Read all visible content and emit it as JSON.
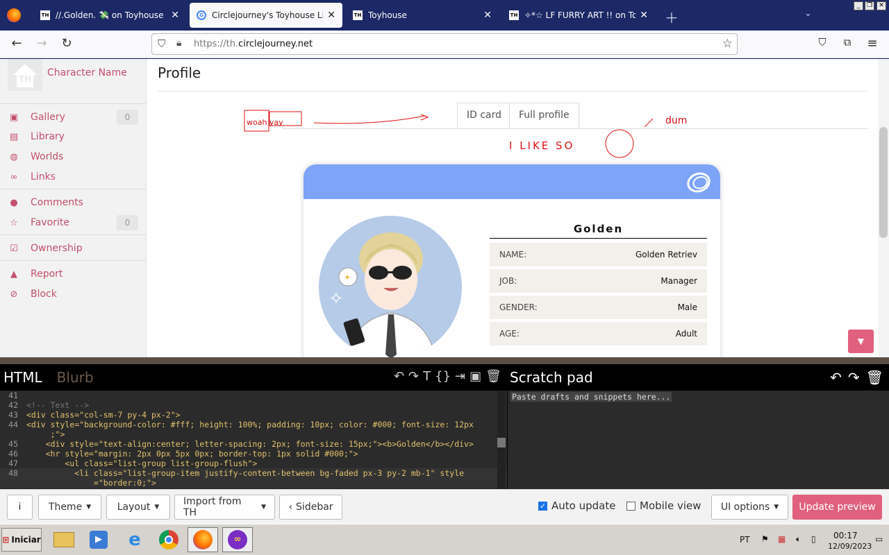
{
  "browser": {
    "tabs": [
      {
        "title": "//.Golden. 💸 on Toyhouse",
        "favicon": "TH",
        "active": false
      },
      {
        "title": "Circlejourney's Toyhouse Live Code Editor",
        "favicon": "G",
        "active": true
      },
      {
        "title": "Toyhouse",
        "favicon": "TH",
        "active": false
      },
      {
        "title": "✧*☆ LF FURRY ART !! on Toyhouse",
        "favicon": "TH",
        "active": false
      }
    ],
    "url_prefix": "https://th.",
    "url_domain": "circlejourney.net"
  },
  "sidebar": {
    "logo_text": "TH",
    "character_name": "Character Name",
    "items": [
      {
        "label": "Gallery",
        "icon": "image-icon",
        "count": "0"
      },
      {
        "label": "Library",
        "icon": "book-icon"
      },
      {
        "label": "Worlds",
        "icon": "globe-icon"
      },
      {
        "label": "Links",
        "icon": "link-icon"
      },
      {
        "label": "Comments",
        "icon": "comment-icon"
      },
      {
        "label": "Favorite",
        "icon": "star-icon",
        "count": "0"
      },
      {
        "label": "Ownership",
        "icon": "check-square-icon"
      },
      {
        "label": "Report",
        "icon": "warning-icon"
      },
      {
        "label": "Block",
        "icon": "ban-icon"
      }
    ]
  },
  "main": {
    "title": "Profile",
    "tabs": [
      "ID card",
      "Full profile"
    ],
    "doodles": {
      "left": "woah yay",
      "middle": "I LIKE SO",
      "right": "dum"
    }
  },
  "card": {
    "name": "Golden",
    "fields": [
      {
        "key": "NAME:",
        "value": "Golden Retriev"
      },
      {
        "key": "JOB:",
        "value": "Manager"
      },
      {
        "key": "GENDER:",
        "value": "Male"
      },
      {
        "key": "AGE:",
        "value": "Adult"
      }
    ],
    "header_color": "#7ea4f8"
  },
  "editor": {
    "tabs": [
      "HTML",
      "Blurb"
    ],
    "code_lines": [
      {
        "n": "41",
        "text": ""
      },
      {
        "n": "42",
        "text": "<!-- Text -->"
      },
      {
        "n": "43",
        "text": "<div class=\"col-sm-7 py-4 px-2\">"
      },
      {
        "n": "44",
        "text": "<div style=\"background-color: #fff; height: 100%; padding: 10px; color: #000; font-size: 12px"
      },
      {
        "n": "",
        "text": "     ;\">"
      },
      {
        "n": "45",
        "text": "    <div style=\"text-align:center; letter-spacing: 2px; font-size: 15px;\"><b>Golden</b></div>"
      },
      {
        "n": "46",
        "text": "    <hr style=\"margin: 2px 0px 5px 0px; border-top: 1px solid #000;\">"
      },
      {
        "n": "47",
        "text": "        <ul class=\"list-group list-group-flush\">"
      },
      {
        "n": "48",
        "text": "          <li class=\"list-group-item justify-content-between bg-faded px-3 py-2 mb-1\" style"
      },
      {
        "n": "",
        "text": "              =\"border:0;\">"
      }
    ],
    "scratch_title": "Scratch pad",
    "scratch_placeholder": "Paste drafts and snippets here..."
  },
  "controls": {
    "info": "i",
    "theme": "Theme",
    "layout": "Layout",
    "import": "Import from TH",
    "sidebar": "Sidebar",
    "auto_update": "Auto update",
    "mobile_view": "Mobile view",
    "ui_options": "UI options",
    "update_preview": "Update preview",
    "auto_update_checked": true,
    "mobile_view_checked": false
  },
  "taskbar": {
    "start": "Iniciar",
    "lang": "PT",
    "time": "00:17",
    "date": "12/09/2023"
  },
  "colors": {
    "accent": "#e0607e",
    "sidebar_link": "#c2506e",
    "taskbar": "#d6d3ce"
  }
}
